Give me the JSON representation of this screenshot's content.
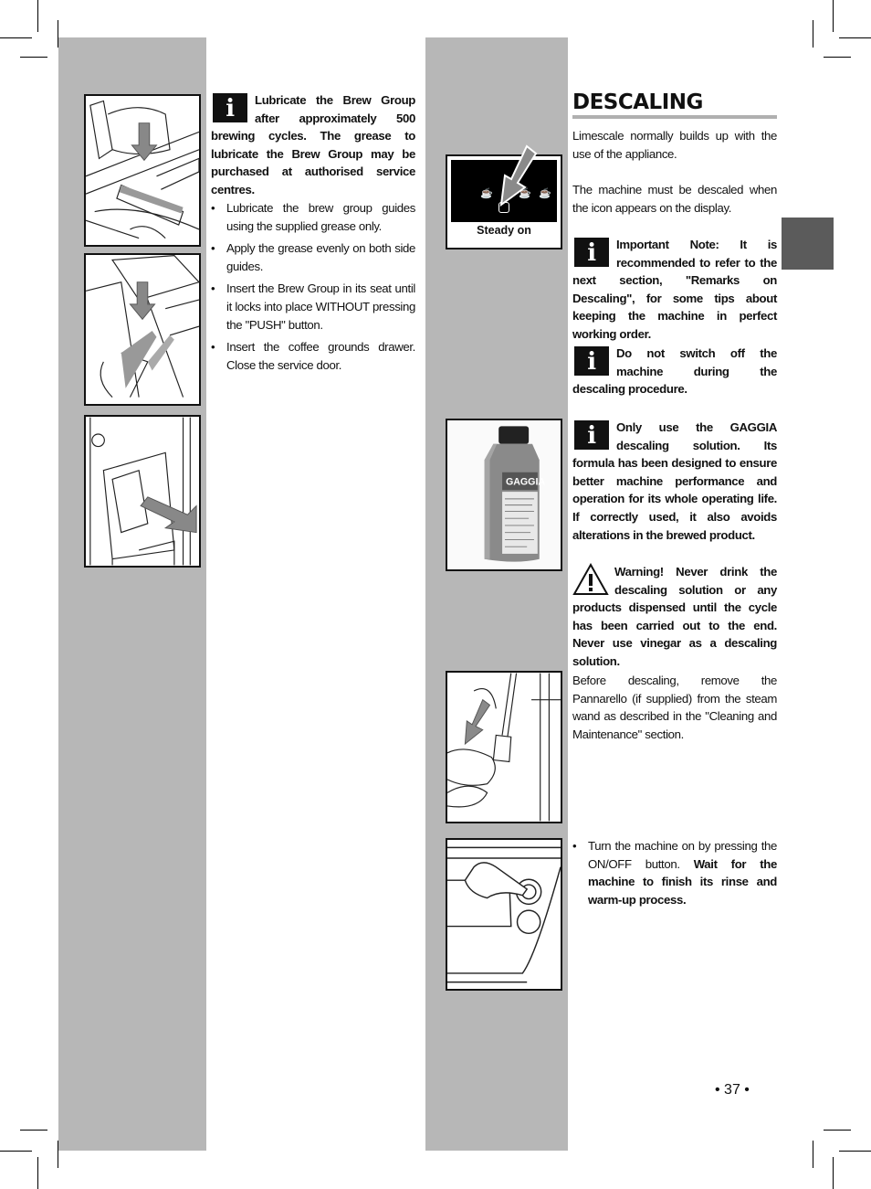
{
  "left_column": {
    "info_note": "Lubricate the Brew Group after approximately 500 brewing cycles. The grease to lubricate the Brew Group may be purchased at authorised service centres.",
    "bullets": [
      "Lubricate the brew group guides using the supplied grease only.",
      "Apply the grease evenly on both side guides.",
      "Insert the Brew Group in its seat until it locks into place WITHOUT pressing the \"PUSH\" button.",
      "Insert the coffee grounds drawer. Close the service door."
    ],
    "figures": [
      "brew-group-grease-illustration",
      "brew-group-guides-illustration",
      "brew-group-insert-illustration"
    ]
  },
  "right_column": {
    "section_title": "DESCALING",
    "intro_1": "Limescale normally builds up with the use of the appliance.",
    "intro_2": "The machine must be descaled when the icon appears on the display.",
    "note_important": "Important Note: It is recommended to refer to the next section, \"Remarks on Descaling\", for some tips about keeping the machine in perfect working order.",
    "note_switch_off": "Do not switch off the machine during the descaling procedure.",
    "note_gaggia": "Only use the GAGGIA descaling solution. Its formula has been designed to ensure better machine performance and operation for its whole operating life. If correctly used, it also avoids alterations in the brewed product.",
    "warning": "Warning! Never drink the descaling solution or any products dispensed until the cycle has been carried out to the end. Never use vinegar as a descaling solution.",
    "pannarello_text": "Before descaling, remove the Pannarello (if supplied) from the steam wand as described in the \"Cleaning and Maintenance\" section.",
    "bullet_plain": "Turn the machine on by pressing the ON/OFF button.",
    "bullet_bold": "Wait for the machine to finish its rinse and warm-up process.",
    "display_caption": "Steady on",
    "bottle_brand": "GAGGIA"
  },
  "icons": {
    "info": "i",
    "warning": "!"
  },
  "page_number": "• 37 •"
}
